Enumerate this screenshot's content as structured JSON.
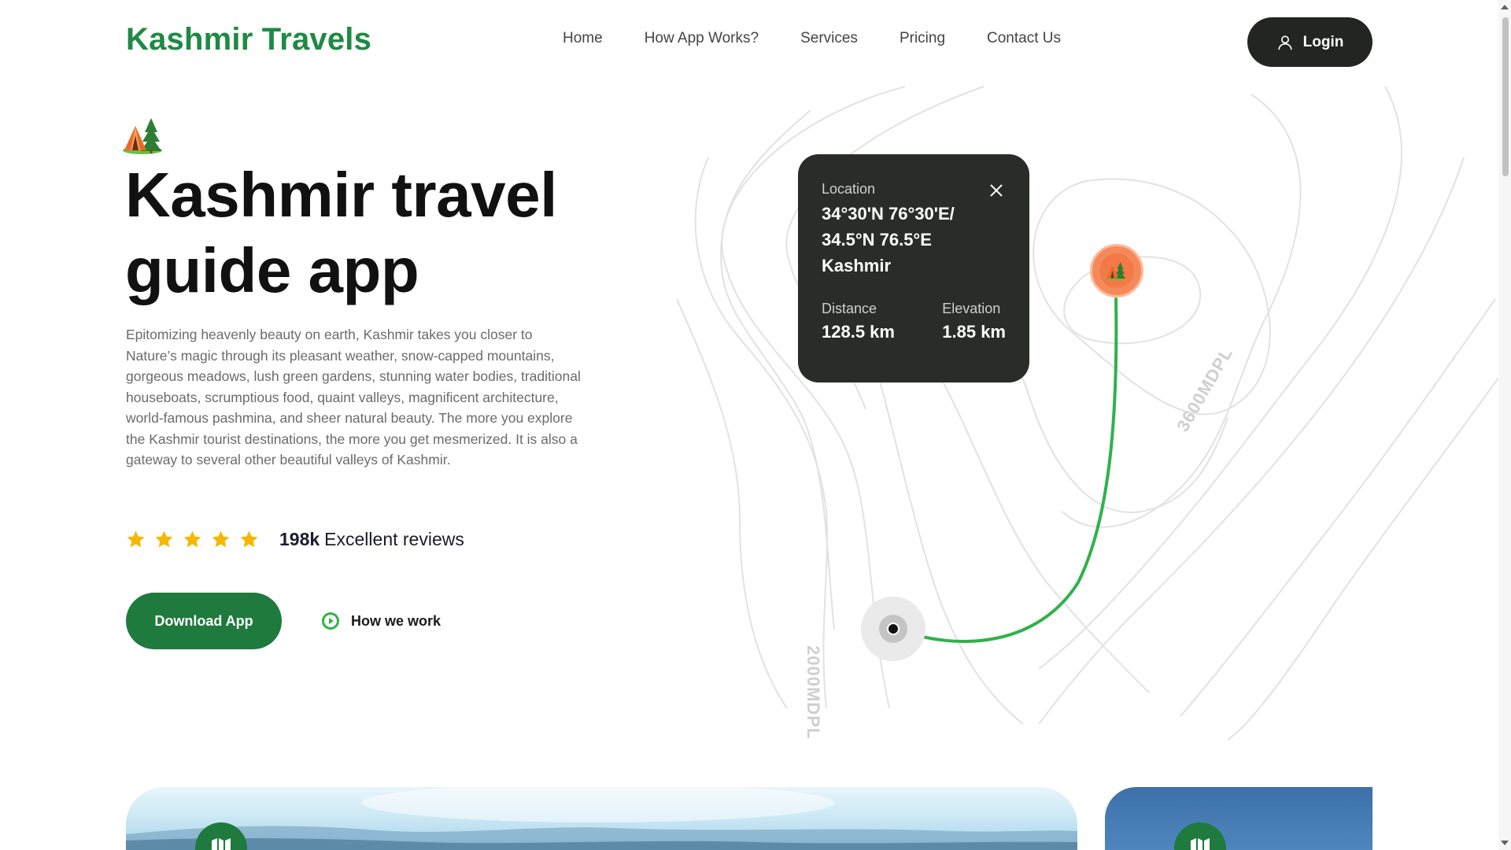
{
  "header": {
    "logo": "Kashmir Travels",
    "nav": [
      "Home",
      "How App Works?",
      "Services",
      "Pricing",
      "Contact Us"
    ],
    "login_label": "Login"
  },
  "hero": {
    "icon": "camping-tent-icon",
    "title_line1": "Kashmir travel",
    "title_line2": "guide app",
    "description": "Epitomizing heavenly beauty on earth, Kashmir takes you closer to Nature’s magic through its pleasant weather, snow-capped mountains, gorgeous meadows, lush green gardens, stunning water bodies, traditional houseboats, scrumptious food, quaint valleys, magnificent architecture, world-famous pashmina, and sheer natural beauty. The more you explore the Kashmir tourist destinations, the more you get mesmerized. It is also a gateway to several other beautiful valleys of Kashmir.",
    "rating": {
      "stars": 5,
      "count": "198k",
      "text": "Excellent reviews"
    },
    "download_label": "Download App",
    "how_we_work_label": "How we work"
  },
  "map": {
    "info_card": {
      "location_label": "Location",
      "coords_line1": "34°30'N 76°30'E/",
      "coords_line2": "34.5°N 76.5°E",
      "coords_line3": "Kashmir",
      "distance_label": "Distance",
      "distance_value": "128.5 km",
      "elevation_label": "Elevation",
      "elevation_value": "1.85 km"
    },
    "contour_labels": [
      "3600MDPL",
      "2000MDPL"
    ],
    "route_color": "#2fb24a",
    "pin_color": "#f47a45"
  },
  "colors": {
    "brand": "#1e8a44",
    "dark": "#222522",
    "star": "#f5b800"
  },
  "cards": {
    "badge_icon": "map-icon"
  }
}
